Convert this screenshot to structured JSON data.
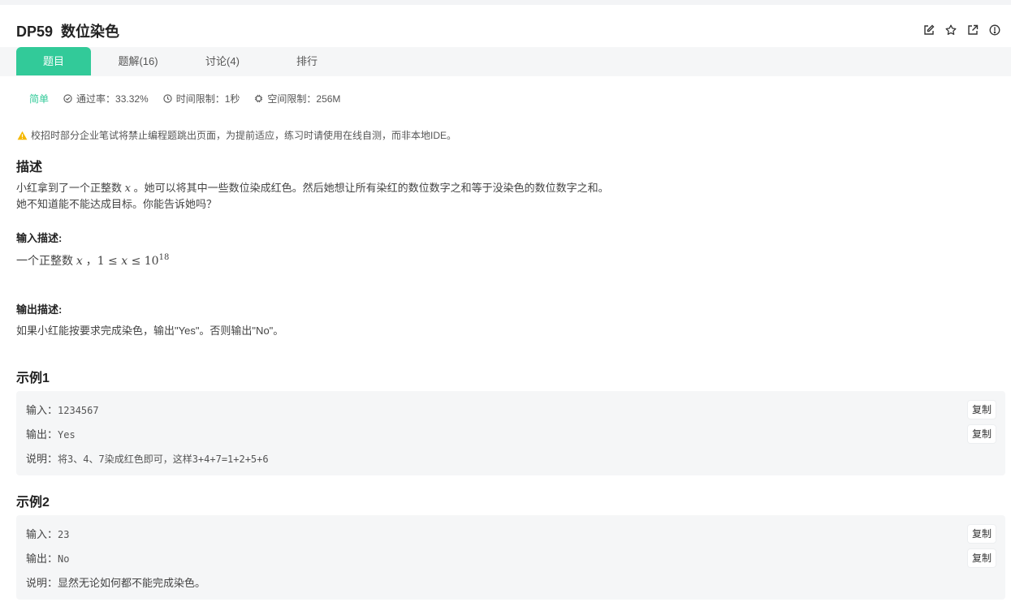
{
  "problem": {
    "id": "DP59",
    "title": "数位染色"
  },
  "header_icons": [
    "edit-icon",
    "star-icon",
    "external-link-icon",
    "info-icon"
  ],
  "tabs": [
    {
      "label": "题目",
      "active": true
    },
    {
      "label": "题解(16)",
      "active": false
    },
    {
      "label": "讨论(4)",
      "active": false
    },
    {
      "label": "排行",
      "active": false
    }
  ],
  "meta": {
    "difficulty": "简单",
    "pass_rate": "通过率：33.32%",
    "time_limit": "时间限制：1秒",
    "memory_limit": "空间限制：256M"
  },
  "notice": "校招时部分企业笔试将禁止编程题跳出页面，为提前适应，练习时请使用在线自测，而非本地IDE。",
  "description": {
    "heading": "描述",
    "line1_pre": "小红拿到了一个正整数 ",
    "line1_var": "x",
    "line1_post": " 。她可以将其中一些数位染成红色。然后她想让所有染红的数位数字之和等于没染色的数位数字之和。",
    "line2": "她不知道能不能达成目标。你能告诉她吗？"
  },
  "input_desc": {
    "heading": "输入描述:",
    "text_pre": "一个正整数 ",
    "var": "x",
    "comma": " ，",
    "expr_lhs": "1 ≤ ",
    "expr_var": "x",
    "expr_rhs": " ≤ 10",
    "expr_exp": "18"
  },
  "output_desc": {
    "heading": "输出描述:",
    "text": "如果小红能按要求完成染色，输出\"Yes\"。否则输出\"No\"。"
  },
  "examples": [
    {
      "heading": "示例1",
      "input_label": "输入：",
      "input": "1234567",
      "output_label": "输出：",
      "output": "Yes",
      "note_label": "说明：",
      "note_text": "将3、4、7染成红色即可，这样3+4+7=1+2+5+6",
      "copy_label": "复制"
    },
    {
      "heading": "示例2",
      "input_label": "输入：",
      "input": "23",
      "output_label": "输出：",
      "output": "No",
      "note_label": "说明：",
      "note_text": "显然无论如何都不能完成染色。",
      "copy_label": "复制"
    }
  ],
  "colors": {
    "accent": "#32ca99",
    "warning": "#f5b800",
    "panel": "#f5f6f7"
  }
}
